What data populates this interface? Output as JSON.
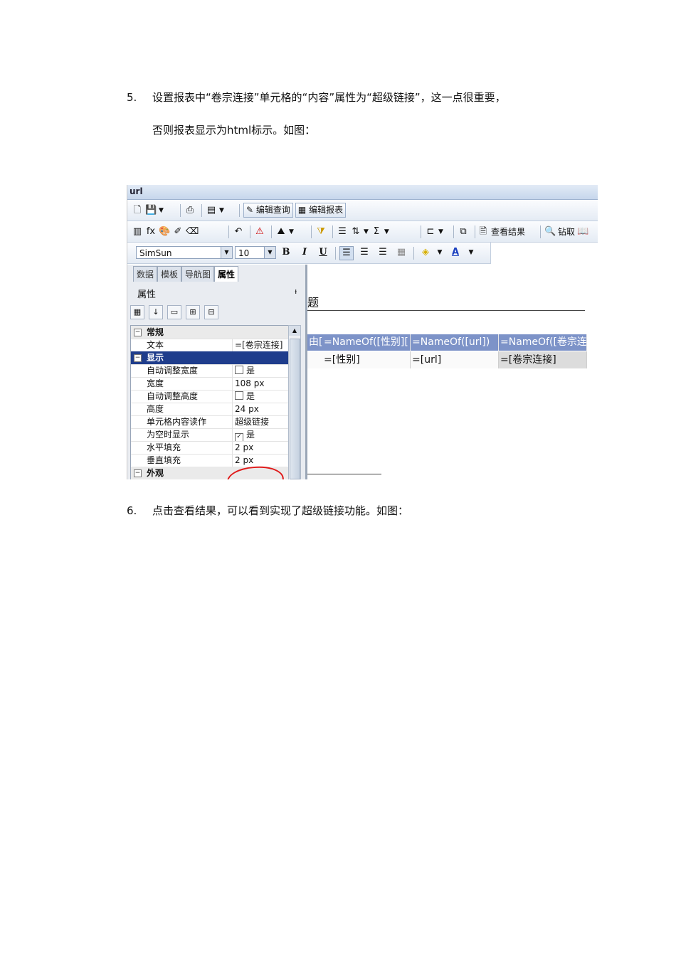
{
  "step5": {
    "number": "5.",
    "line1": "设置报表中“卷宗连接”单元格的“内容”属性为“超级链接”，这一点很重要，",
    "line2": "否则报表显示为html标示。如图："
  },
  "step6": {
    "number": "6.",
    "text": "点击查看结果，可以看到实现了超级链接功能。如图："
  },
  "screenshot": {
    "window_title": "url",
    "toolbar1": {
      "edit_query": "编辑查询",
      "edit_report": "编辑报表"
    },
    "toolbar2": {
      "view_result": "查看结果",
      "drill": "钻取"
    },
    "font_toolbar": {
      "font_name": "SimSun",
      "font_size": "10",
      "bold": "B",
      "italic": "I",
      "underline": "U",
      "font_color": "A"
    },
    "panel": {
      "tabs": [
        "数据",
        "模板",
        "导航图",
        "属性"
      ],
      "title": "属性",
      "pin": "ᵼ",
      "rows": [
        {
          "key": "常规",
          "value": "",
          "type": "category",
          "toggle": "⊟"
        },
        {
          "key": "文本",
          "value": "=[卷宗连接]",
          "type": "prop"
        },
        {
          "key": "显示",
          "value": "",
          "type": "selected-category",
          "toggle": "⊟"
        },
        {
          "key": "自动调整宽度",
          "value": "是",
          "type": "check",
          "checked": ""
        },
        {
          "key": "宽度",
          "value": "108 px",
          "type": "prop"
        },
        {
          "key": "自动调整高度",
          "value": "是",
          "type": "check",
          "checked": ""
        },
        {
          "key": "高度",
          "value": "24 px",
          "type": "prop"
        },
        {
          "key": "单元格内容读作",
          "value": "超级链接",
          "type": "prop"
        },
        {
          "key": "为空时显示",
          "value": "是",
          "type": "check",
          "checked": "✓"
        },
        {
          "key": "水平填充",
          "value": "2 px",
          "type": "prop"
        },
        {
          "key": "垂直填充",
          "value": "2 px",
          "type": "prop"
        },
        {
          "key": "外观",
          "value": "",
          "type": "category",
          "toggle": "⊟"
        }
      ]
    },
    "designer": {
      "title_fragment": "题",
      "headers": [
        "由[",
        "=NameOf([性别][",
        "=NameOf([url])",
        "=NameOf([卷宗连"
      ],
      "cells": [
        "",
        "=[性别]",
        "=[url]",
        "=[卷宗连接]"
      ]
    }
  }
}
